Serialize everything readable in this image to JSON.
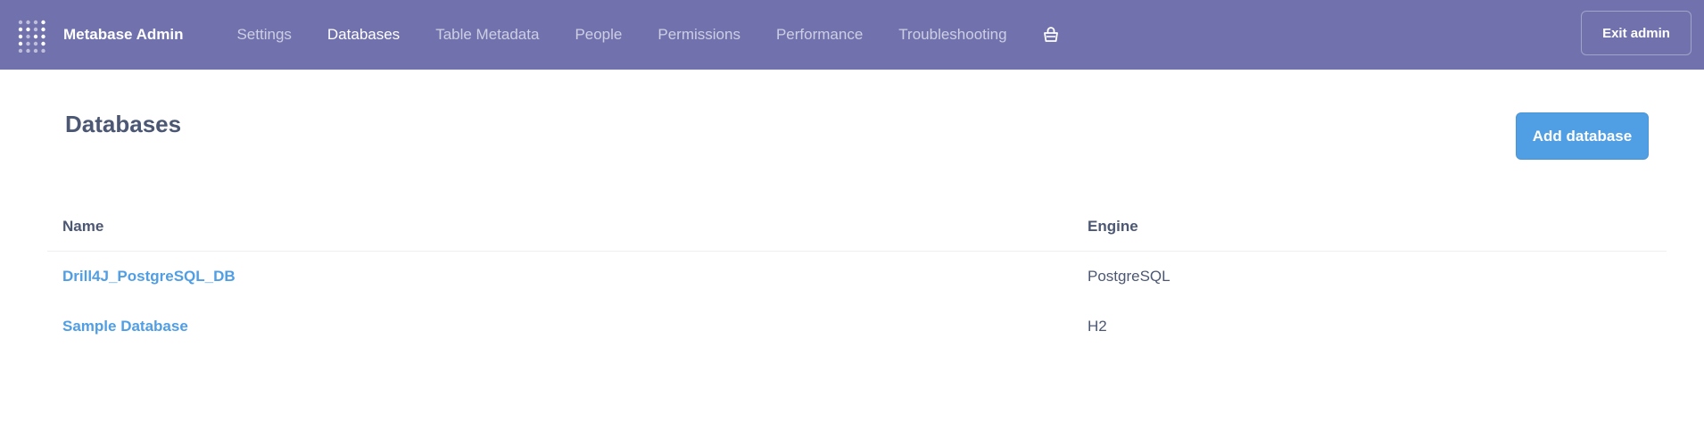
{
  "navbar": {
    "brand_title": "Metabase Admin",
    "links": [
      {
        "label": "Settings",
        "active": false
      },
      {
        "label": "Databases",
        "active": true
      },
      {
        "label": "Table Metadata",
        "active": false
      },
      {
        "label": "People",
        "active": false
      },
      {
        "label": "Permissions",
        "active": false
      },
      {
        "label": "Performance",
        "active": false
      },
      {
        "label": "Troubleshooting",
        "active": false
      }
    ],
    "store_icon": "shopping-bag-icon",
    "exit_label": "Exit admin"
  },
  "main": {
    "title": "Databases",
    "add_button_label": "Add database",
    "table": {
      "headers": {
        "name": "Name",
        "engine": "Engine"
      },
      "rows": [
        {
          "name": "Drill4J_PostgreSQL_DB",
          "engine": "PostgreSQL"
        },
        {
          "name": "Sample Database",
          "engine": "H2"
        }
      ]
    }
  },
  "colors": {
    "navbar_bg": "#7172ad",
    "brand_blue": "#509ee3",
    "text_dark": "#4c5773"
  }
}
